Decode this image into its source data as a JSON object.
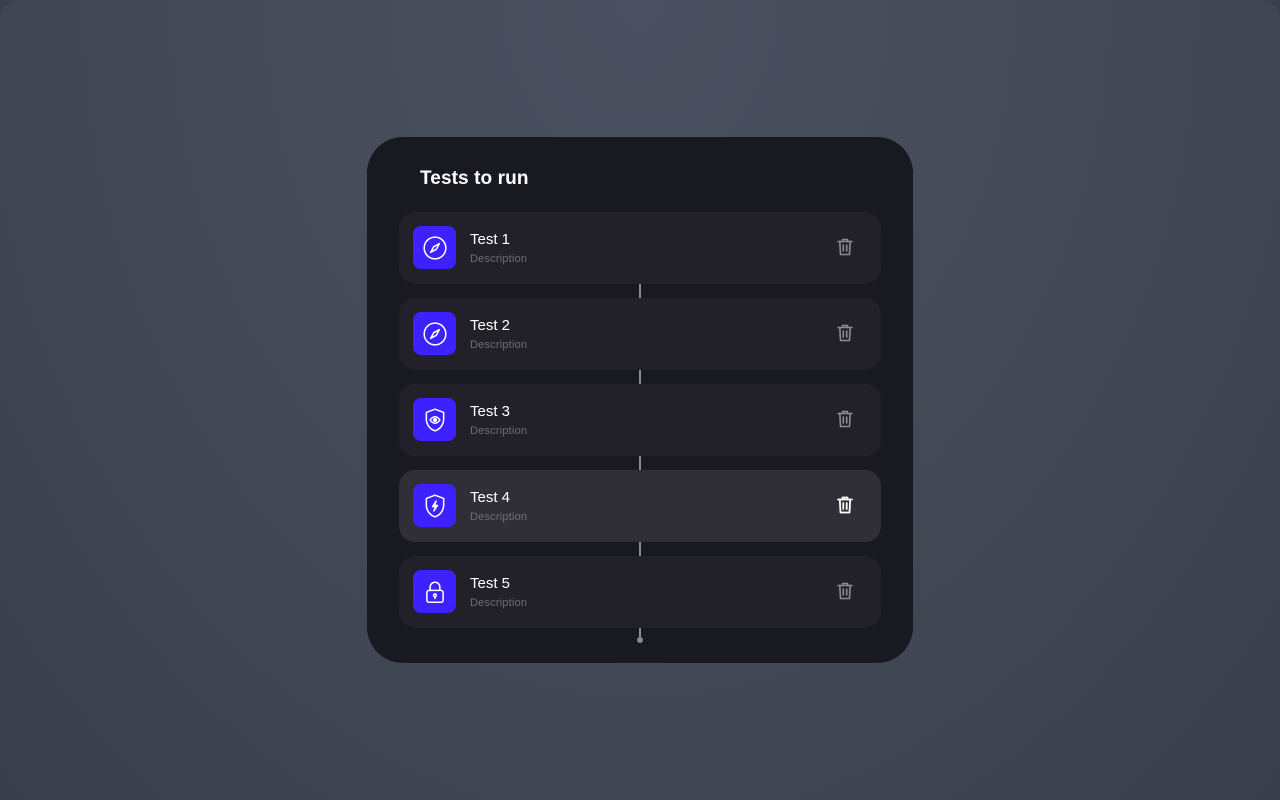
{
  "panel": {
    "title": "Tests to run"
  },
  "tests": [
    {
      "title": "Test 1",
      "description": "Description",
      "icon": "compass-icon",
      "active": false
    },
    {
      "title": "Test 2",
      "description": "Description",
      "icon": "compass-icon",
      "active": false
    },
    {
      "title": "Test 3",
      "description": "Description",
      "icon": "shield-eye-icon",
      "active": false
    },
    {
      "title": "Test 4",
      "description": "Description",
      "icon": "shield-bolt-icon",
      "active": true
    },
    {
      "title": "Test 5",
      "description": "Description",
      "icon": "lock-icon",
      "active": false
    }
  ],
  "colors": {
    "accent": "#3d22ff",
    "card": "#191922",
    "item": "#22212a",
    "item_active": "#302f37",
    "trash_idle": "#8b8b92",
    "trash_active": "#ffffff"
  }
}
